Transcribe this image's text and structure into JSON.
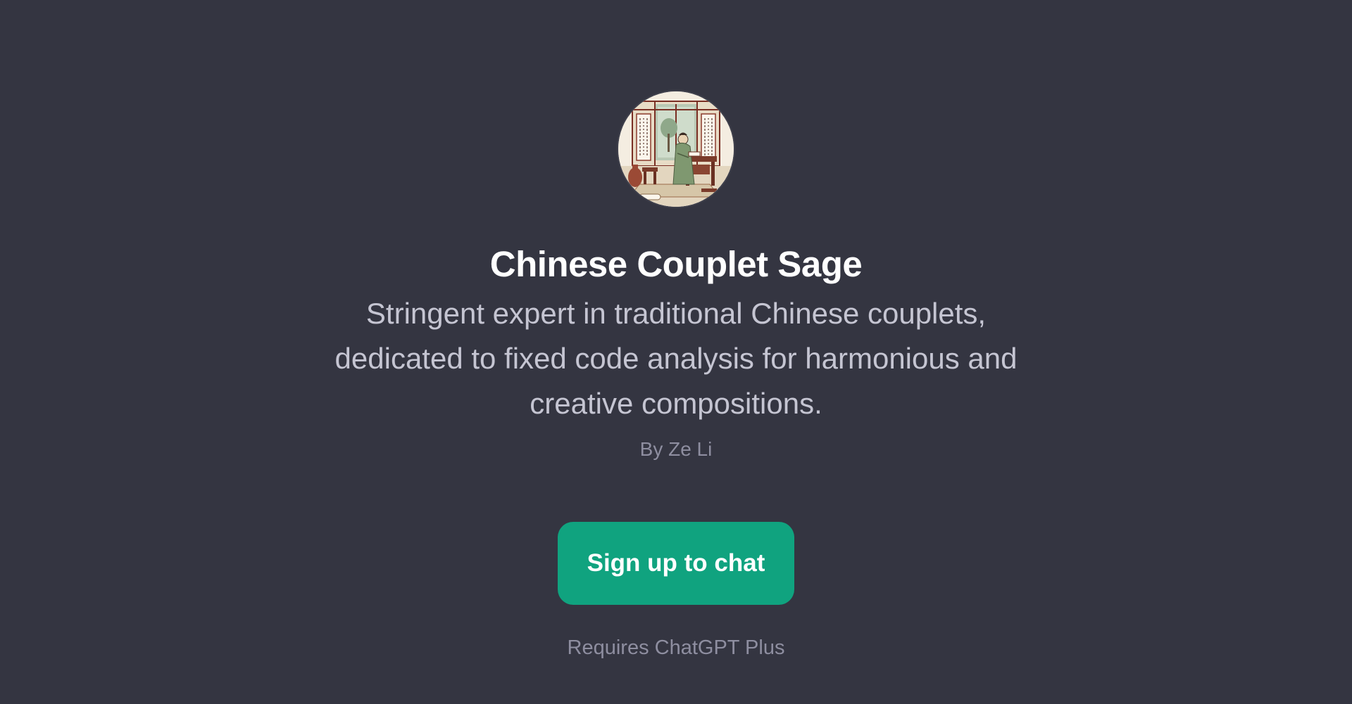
{
  "gpt": {
    "avatar_icon": "scholar-study-illustration",
    "title": "Chinese Couplet Sage",
    "description": "Stringent expert in traditional Chinese couplets, dedicated to fixed code analysis for harmonious and creative compositions.",
    "author": "By Ze Li"
  },
  "actions": {
    "signup_label": "Sign up to chat",
    "requirement": "Requires ChatGPT Plus"
  },
  "colors": {
    "background": "#343541",
    "accent": "#10a37f",
    "title": "#ffffff",
    "description": "#c5c5d2",
    "muted": "#8e8ea0"
  }
}
